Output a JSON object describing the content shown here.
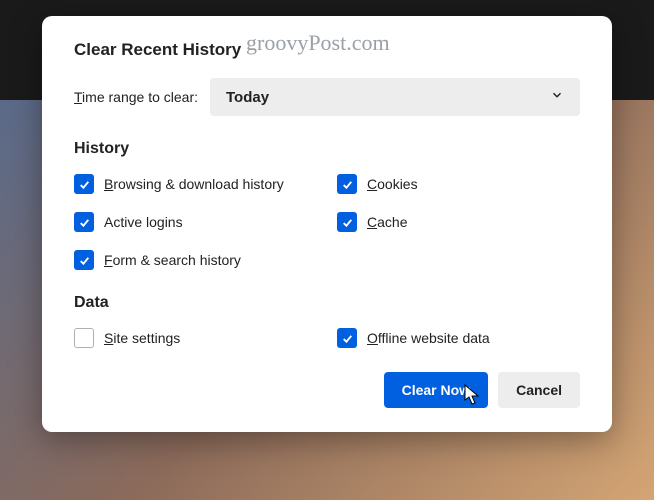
{
  "watermark": "groovyPost.com",
  "dialog": {
    "title": "Clear Recent History",
    "range_label_prefix": "T",
    "range_label_rest": "ime range to clear:",
    "dropdown_value": "Today",
    "sections": {
      "history": {
        "title": "History",
        "items": {
          "browsing": {
            "prefix": "B",
            "rest": "rowsing & download history",
            "checked": true
          },
          "cookies": {
            "prefix": "C",
            "rest": "ookies",
            "checked": true
          },
          "logins": {
            "prefix": "",
            "rest": "Active logins",
            "checked": true
          },
          "cache": {
            "prefix": "C",
            "rest": "ache",
            "checked": true
          },
          "form": {
            "prefix": "F",
            "rest": "orm & search history",
            "checked": true
          }
        }
      },
      "data": {
        "title": "Data",
        "items": {
          "site": {
            "prefix": "S",
            "rest": "ite settings",
            "checked": false
          },
          "offline": {
            "prefix": "O",
            "rest": "ffline website data",
            "checked": true
          }
        }
      }
    },
    "buttons": {
      "clear": "Clear Now",
      "cancel": "Cancel"
    }
  }
}
